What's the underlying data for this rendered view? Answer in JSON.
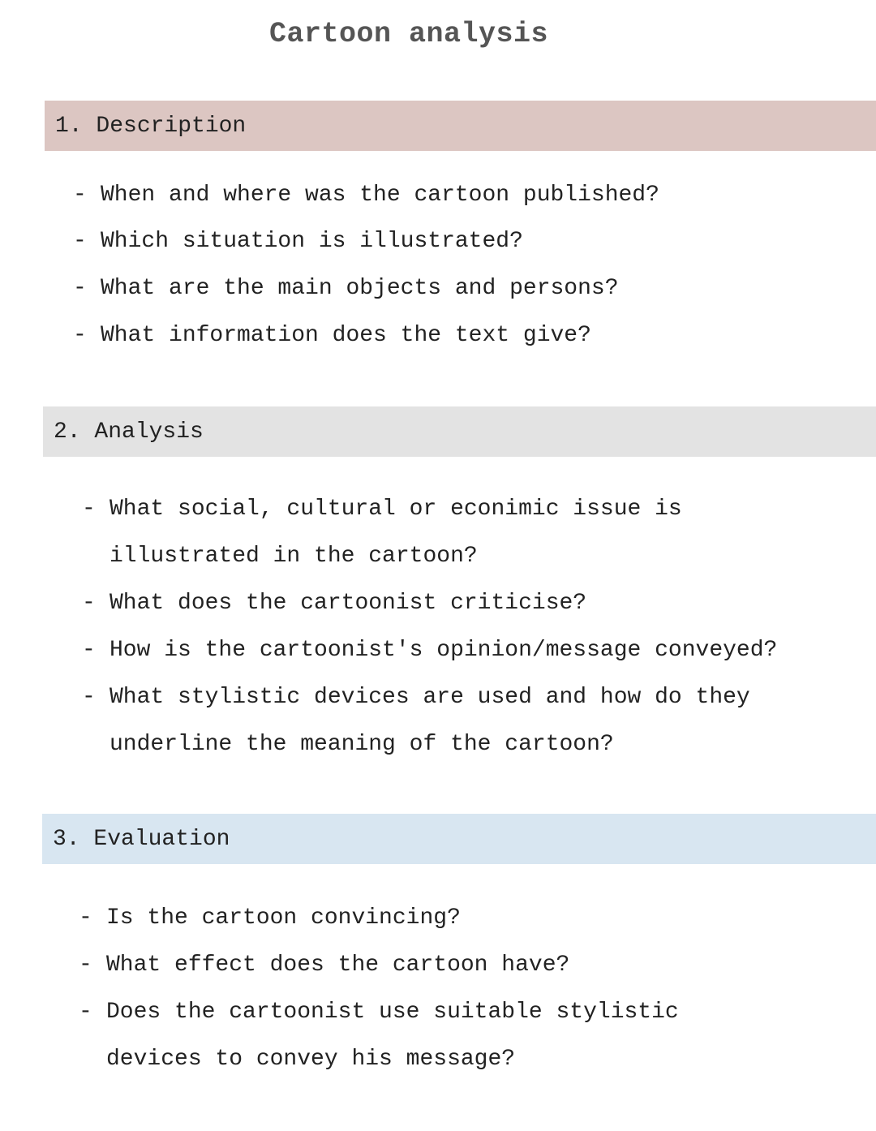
{
  "title": "Cartoon analysis",
  "sections": [
    {
      "heading": "1. Description",
      "color": "#dcc6c2",
      "items": [
        [
          "When and where was the cartoon published?"
        ],
        [
          "Which situation is illustrated?"
        ],
        [
          "What are the main objects and persons?"
        ],
        [
          "What information does the text give?"
        ]
      ]
    },
    {
      "heading": "2. Analysis",
      "color": "#e3e3e3",
      "items": [
        [
          "What social, cultural or econimic issue is",
          "illustrated in the cartoon?"
        ],
        [
          "What does the cartoonist criticise?"
        ],
        [
          "How is the cartoonist's opinion/message conveyed?"
        ],
        [
          "What stylistic devices are used and how do they",
          "underline the meaning of the cartoon?"
        ]
      ]
    },
    {
      "heading": "3. Evaluation",
      "color": "#d8e6f1",
      "items": [
        [
          "Is the cartoon convincing?"
        ],
        [
          "What effect does the cartoon have?"
        ],
        [
          "Does the cartoonist use suitable stylistic",
          "devices to convey his message?"
        ]
      ]
    }
  ],
  "bullet": "-"
}
